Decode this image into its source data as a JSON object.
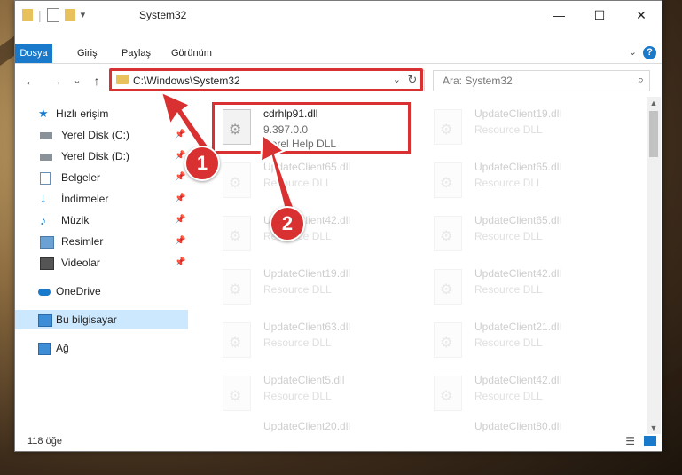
{
  "window": {
    "title": "System32",
    "controls": {
      "minimize": "—",
      "maximize": "☐",
      "close": "✕"
    }
  },
  "ribbon": {
    "tabs": [
      "Dosya",
      "Giriş",
      "Paylaş",
      "Görünüm"
    ],
    "help": "?"
  },
  "nav": {
    "back": "←",
    "forward": "→",
    "recent": "⌄",
    "up": "↑",
    "address": "C:\\Windows\\System32",
    "refresh": "↻",
    "search_placeholder": "Ara: System32"
  },
  "sidebar": {
    "items": [
      {
        "label": "Hızlı erişim",
        "icon": "star-icon",
        "pinned": false,
        "selected": false,
        "top": true
      },
      {
        "label": "Yerel Disk (C:)",
        "icon": "drive-icon",
        "pinned": true,
        "selected": false
      },
      {
        "label": "Yerel Disk (D:)",
        "icon": "drive-icon",
        "pinned": true,
        "selected": false
      },
      {
        "label": "Belgeler",
        "icon": "documents-icon",
        "pinned": true,
        "selected": false
      },
      {
        "label": "İndirmeler",
        "icon": "download-icon",
        "pinned": true,
        "selected": false
      },
      {
        "label": "Müzik",
        "icon": "music-icon",
        "pinned": true,
        "selected": false
      },
      {
        "label": "Resimler",
        "icon": "pictures-icon",
        "pinned": true,
        "selected": false
      },
      {
        "label": "Videolar",
        "icon": "videos-icon",
        "pinned": true,
        "selected": false
      },
      {
        "label": "OneDrive",
        "icon": "cloud-icon",
        "pinned": false,
        "selected": false,
        "top": true
      },
      {
        "label": "Bu bilgisayar",
        "icon": "computer-icon",
        "pinned": false,
        "selected": true,
        "top": true
      },
      {
        "label": "Ağ",
        "icon": "network-icon",
        "pinned": false,
        "selected": false,
        "top": true
      }
    ]
  },
  "files": {
    "highlighted": {
      "name": "cdrhlp91.dll",
      "version": "9.397.0.0",
      "description": "Corel Help DLL"
    },
    "faded": [
      {
        "name": "UpdateClient19.dll",
        "description": "Resource DLL"
      },
      {
        "name": "UpdateClient65.dll",
        "description": "Resource DLL"
      },
      {
        "name": "UpdateClient65.dll",
        "description": "Resource DLL"
      },
      {
        "name": "UpdateClient42.dll",
        "description": "Resource DLL"
      },
      {
        "name": "UpdateClient65.dll",
        "description": "Resource DLL"
      },
      {
        "name": "UpdateClient19.dll",
        "description": "Resource DLL"
      },
      {
        "name": "UpdateClient42.dll",
        "description": "Resource DLL"
      },
      {
        "name": "UpdateClient63.dll",
        "description": "Resource DLL"
      },
      {
        "name": "UpdateClient21.dll",
        "description": "Resource DLL"
      },
      {
        "name": "UpdateClient5.dll",
        "description": "Resource DLL"
      },
      {
        "name": "UpdateClient42.dll",
        "description": "Resource DLL"
      },
      {
        "name": "UpdateClient20.dll",
        "description": "Resource DLL"
      },
      {
        "name": "UpdateClient80.dll",
        "description": "Resource DLL"
      }
    ]
  },
  "status": {
    "count": "118 öğe"
  },
  "annotations": {
    "step1": "1",
    "step2": "2",
    "color": "#d93131"
  }
}
